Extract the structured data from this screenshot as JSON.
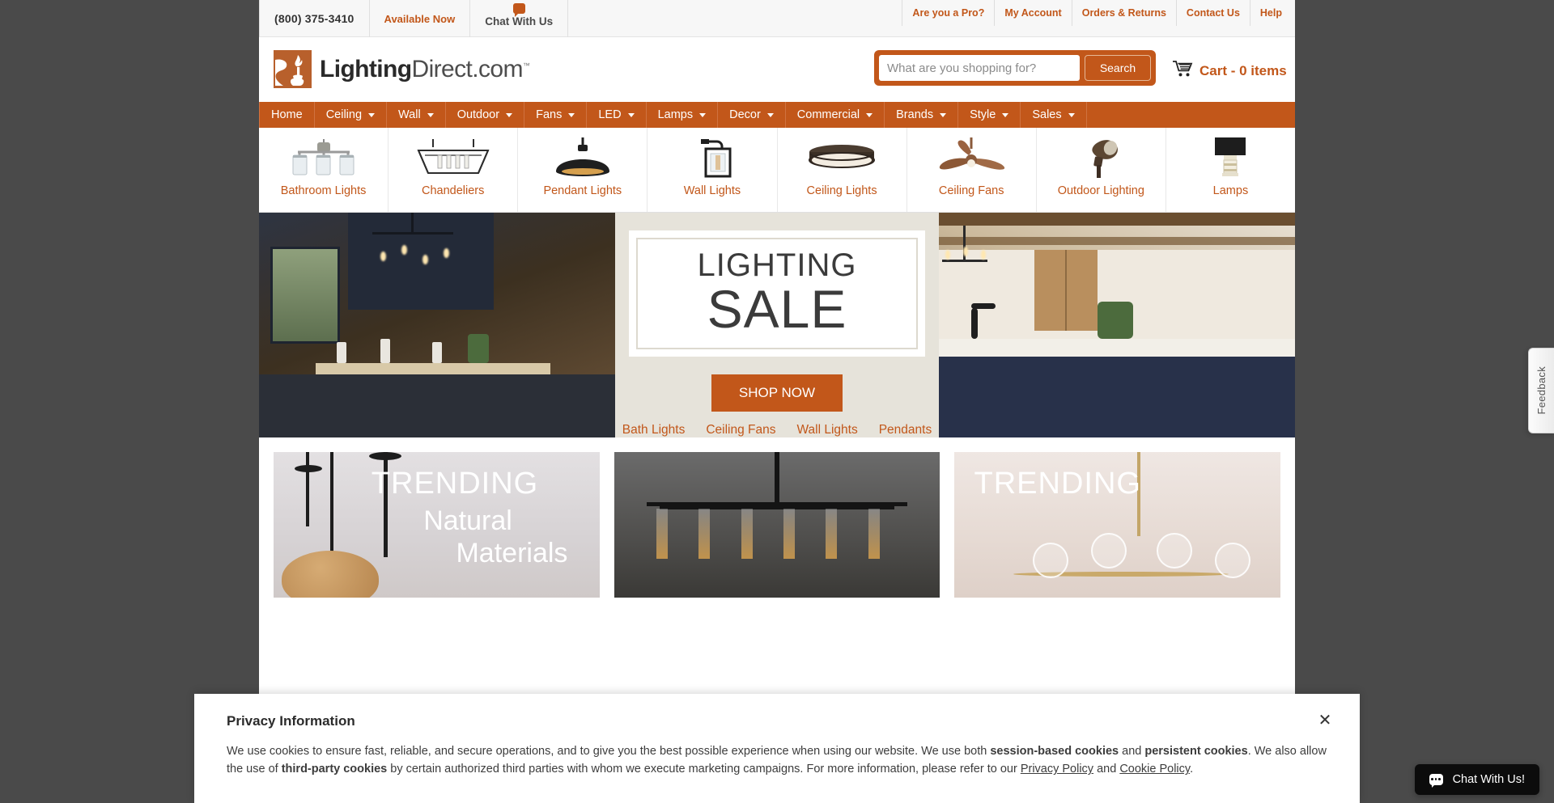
{
  "utility": {
    "phone": "(800) 375-3410",
    "available": "Available Now",
    "chat_label": "Chat With Us",
    "links": [
      "Are you a Pro?",
      "My Account",
      "Orders & Returns",
      "Contact Us",
      "Help"
    ]
  },
  "brand": {
    "name_bold": "Lighting",
    "name_thin": "Direct.com",
    "tm": "™"
  },
  "search": {
    "placeholder": "What are you shopping for?",
    "value": "",
    "button": "Search"
  },
  "cart": {
    "label": "Cart - 0 items"
  },
  "nav": {
    "items": [
      {
        "label": "Home",
        "caret": false
      },
      {
        "label": "Ceiling",
        "caret": true
      },
      {
        "label": "Wall",
        "caret": true
      },
      {
        "label": "Outdoor",
        "caret": true
      },
      {
        "label": "Fans",
        "caret": true
      },
      {
        "label": "LED",
        "caret": true
      },
      {
        "label": "Lamps",
        "caret": true
      },
      {
        "label": "Decor",
        "caret": true
      },
      {
        "label": "Commercial",
        "caret": true
      },
      {
        "label": "Brands",
        "caret": true
      },
      {
        "label": "Style",
        "caret": true
      },
      {
        "label": "Sales",
        "caret": true
      }
    ]
  },
  "categories": [
    {
      "label": "Bathroom Lights",
      "icon": "vanity-light-icon"
    },
    {
      "label": "Chandeliers",
      "icon": "lantern-chandelier-icon"
    },
    {
      "label": "Pendant Lights",
      "icon": "dome-pendant-icon"
    },
    {
      "label": "Wall Lights",
      "icon": "wall-sconce-icon"
    },
    {
      "label": "Ceiling Lights",
      "icon": "flush-mount-icon"
    },
    {
      "label": "Ceiling Fans",
      "icon": "ceiling-fan-icon"
    },
    {
      "label": "Outdoor Lighting",
      "icon": "landscape-spotlight-icon"
    },
    {
      "label": "Lamps",
      "icon": "table-lamp-icon"
    }
  ],
  "hero": {
    "title_line1": "LIGHTING",
    "title_line2": "SALE",
    "cta": "SHOP NOW",
    "links": [
      "Bath Lights",
      "Ceiling Fans",
      "Wall Lights",
      "Pendants"
    ]
  },
  "trending": [
    {
      "head": "TRENDING",
      "sub1": "Natural",
      "sub2": "Materials"
    },
    {
      "head": "",
      "sub1": "",
      "sub2": ""
    },
    {
      "head": "TRENDING",
      "sub1": "",
      "sub2": ""
    }
  ],
  "privacy": {
    "title": "Privacy Information",
    "p1a": "We use cookies to ensure fast, reliable, and secure operations, and to give you the best possible experience when using our website. We use both ",
    "b1": "session-based cookies",
    "p1b": " and ",
    "b2": "persistent cookies",
    "p1c": ". We also allow the use of ",
    "b3": "third-party cookies",
    "p1d": " by certain authorized third parties with whom we execute marketing campaigns. For more information, please refer to our ",
    "link1": "Privacy Policy",
    "p1e": " and ",
    "link2": "Cookie Policy",
    "p1f": ".",
    "close": "✕"
  },
  "widgets": {
    "feedback": "Feedback",
    "chat": "Chat With Us!"
  },
  "colors": {
    "brand_orange": "#c2571a",
    "nav_bg": "#c2571a",
    "hero_bg": "#e6e3da"
  }
}
